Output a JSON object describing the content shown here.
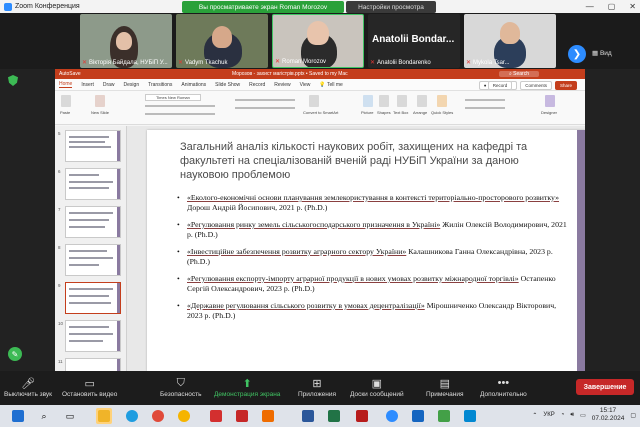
{
  "zoom": {
    "window_title": "Zoom Конференция",
    "share_banner": "Вы просматриваете экран Roman Morozov",
    "view_settings": "Настройки просмотра",
    "view_button": "Вид"
  },
  "participants": [
    {
      "name": "Вікторія Байдала, НУБіП У..."
    },
    {
      "name": "Vadym Tkachuk"
    },
    {
      "name": "Roman Morozov"
    },
    {
      "name": "Anatolii Bondarenko",
      "big_label": "Anatolii Bondar..."
    },
    {
      "name": "Mykola Tsar..."
    }
  ],
  "ppt": {
    "autosave": "AutoSave",
    "filename": "Морозов - захист магістрів.pptx • Saved to my Mac",
    "search": "Search",
    "tabs": [
      "Home",
      "Insert",
      "Draw",
      "Design",
      "Transitions",
      "Animations",
      "Slide Show",
      "Record",
      "Review",
      "View",
      "Tell me"
    ],
    "record": "Record",
    "comments": "Comments",
    "share": "Share",
    "ribbon": {
      "paste": "Paste",
      "new_slide": "New Slide",
      "font": "Times New Roman",
      "convert": "Convert to SmartArt",
      "picture": "Picture",
      "shapes": "Shapes",
      "textbox": "Text Box",
      "arrange": "Arrange",
      "quick_styles": "Quick Styles",
      "designer": "Designer"
    }
  },
  "slide": {
    "title": "Загальний аналіз кількості наукових робіт, захищених на кафедрі та факультеті на спеціалізованій вченій раді НУБіП України за даною науковою проблемою",
    "items": [
      {
        "work": "«Еколого-економічні основи планування землекористування в контексті територіально-просторового розвитку»",
        "author": " Дорош Андрій Йосипович, 2021 р. (Ph.D.)"
      },
      {
        "work": "«Регулювання ринку земель сільськогосподарського призначення в Україні»",
        "author": " Жилін Олексій Володимирович, 2021 р. (Ph.D.)"
      },
      {
        "work": "«Інвестиційне забезпечення розвитку аграрного сектору України»",
        "author": " Калашникова Ганна Олександрівна, 2023 р. (Ph.D.)"
      },
      {
        "work": "«Регулювання експорту-імпорту аграрної продукції в нових умовах розвитку міжнародної торгівлі»",
        "author": " Остапенко Сергій Олександрович, 2023 р. (Ph.D.)"
      },
      {
        "work": "«Державне регулювання сільського розвитку в умовах децентралізації»",
        "author": " Мірошниченко Олександр Вікторович, 2023 р. (Ph.D.)"
      }
    ]
  },
  "toolbar": {
    "mute": "Выключить звук",
    "stop_video": "Остановить видео",
    "security": "Безопасность",
    "share_screen": "Демонстрация экрана",
    "apps": "Приложения",
    "whiteboards": "Доски сообщений",
    "notes": "Примечания",
    "more": "Дополнительно",
    "end": "Завершение"
  },
  "taskbar": {
    "lang": "УКР",
    "time": "15:17",
    "date": "07.02.2024"
  },
  "colors": {
    "ppt_accent": "#c43e1c",
    "zoom_green": "#2aa13a",
    "end_red": "#c62828",
    "zoom_blue": "#2d8cff"
  }
}
